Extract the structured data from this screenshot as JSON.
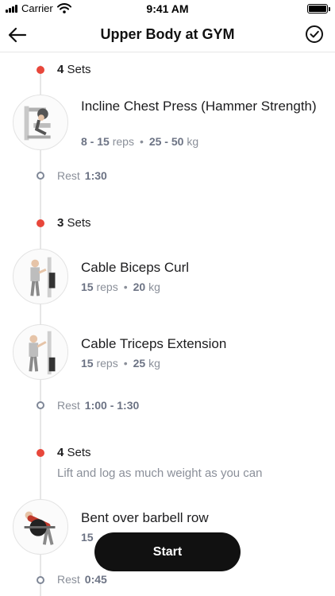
{
  "status_bar": {
    "carrier": "Carrier",
    "time": "9:41 AM"
  },
  "nav": {
    "title": "Upper Body at GYM",
    "back_icon": "arrow-left-icon",
    "done_icon": "check-circle-icon"
  },
  "blocks": [
    {
      "sets_count": "4",
      "sets_label": "Sets",
      "note": "",
      "exercises": [
        {
          "name": "Incline Chest Press (Hammer Strength)",
          "reps": "8 - 15",
          "reps_unit": "reps",
          "weight": "25 - 50",
          "weight_unit": "kg"
        }
      ],
      "rest_label": "Rest",
      "rest_value": "1:30"
    },
    {
      "sets_count": "3",
      "sets_label": "Sets",
      "note": "",
      "exercises": [
        {
          "name": "Cable Biceps Curl",
          "reps": "15",
          "reps_unit": "reps",
          "weight": "20",
          "weight_unit": "kg"
        },
        {
          "name": "Cable Triceps Extension",
          "reps": "15",
          "reps_unit": "reps",
          "weight": "25",
          "weight_unit": "kg"
        }
      ],
      "rest_label": "Rest",
      "rest_value": "1:00 - 1:30"
    },
    {
      "sets_count": "4",
      "sets_label": "Sets",
      "note": "Lift and log as much weight as you can",
      "exercises": [
        {
          "name": "Bent over barbell row",
          "reps": "15",
          "reps_unit": "",
          "weight": "",
          "weight_unit": ""
        }
      ],
      "rest_label": "Rest",
      "rest_value": "0:45"
    }
  ],
  "start_button": {
    "label": "Start"
  },
  "colors": {
    "accent_red": "#e8473b",
    "button_bg": "#111111",
    "muted_text": "#8a8f99"
  }
}
